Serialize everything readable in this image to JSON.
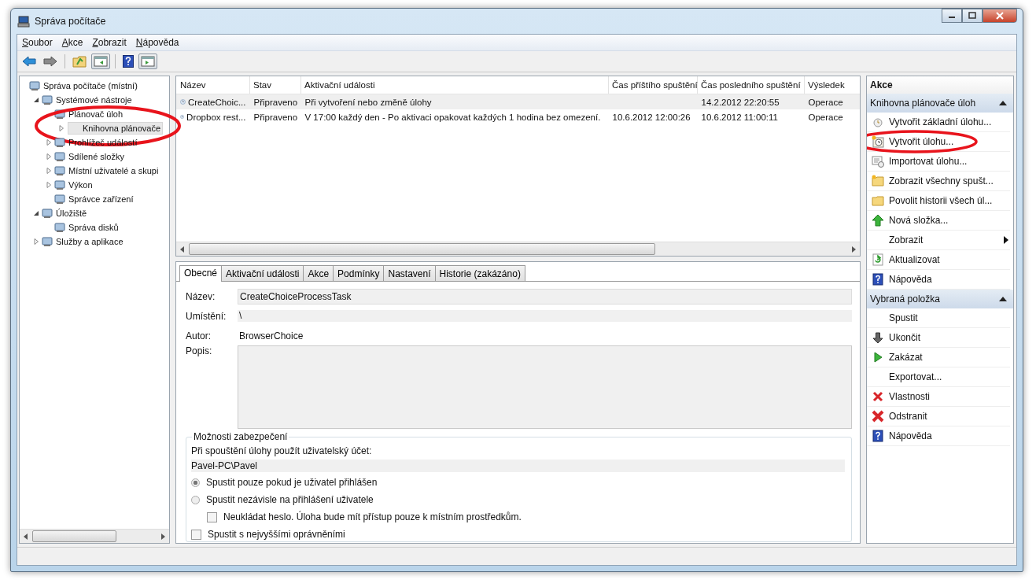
{
  "window": {
    "title": "Správa počítače"
  },
  "menu": [
    "Soubor",
    "Akce",
    "Zobrazit",
    "Nápověda"
  ],
  "tree": [
    {
      "label": "Správa počítače (místní)",
      "selected": false,
      "children": [
        {
          "label": "Systémové nástroje",
          "expanded": true,
          "selected": false,
          "children": [
            {
              "label": "Plánovač úloh",
              "selected": false,
              "children": [
                {
                  "label": "Knihovna plánovače",
                  "expanded": false,
                  "selected": true,
                  "circled": true
                }
              ]
            },
            {
              "label": "Prohlížeč událostí",
              "expanded": false,
              "selected": false
            },
            {
              "label": "Sdílené složky",
              "expanded": false,
              "selected": false
            },
            {
              "label": "Místní uživatelé a skupi",
              "expanded": false,
              "selected": false
            },
            {
              "label": "Výkon",
              "expanded": false,
              "selected": false
            },
            {
              "label": "Správce zařízení",
              "selected": false
            }
          ]
        },
        {
          "label": "Úložiště",
          "expanded": true,
          "selected": false,
          "children": [
            {
              "label": "Správa disků",
              "selected": false
            }
          ]
        },
        {
          "label": "Služby a aplikace",
          "expanded": false,
          "selected": false
        }
      ]
    }
  ],
  "table": {
    "columns": [
      "Název",
      "Stav",
      "Aktivační události",
      "Čas příštího spuštění",
      "Čas posledního spuštění",
      "Výsledek"
    ],
    "rows": [
      {
        "selected": true,
        "cells": [
          "CreateChoic...",
          "Připraveno",
          "Při vytvoření nebo změně úlohy",
          "",
          "14.2.2012 22:20:55",
          "Operace"
        ]
      },
      {
        "selected": false,
        "cells": [
          "Dropbox rest...",
          "Připraveno",
          "V 17:00 každý den - Po aktivaci opakovat každých 1 hodina bez omezení.",
          "10.6.2012 12:00:26",
          "10.6.2012 11:00:11",
          "Operace"
        ]
      }
    ]
  },
  "tabs": [
    {
      "label": "Obecné",
      "selected": true
    },
    {
      "label": "Aktivační události",
      "selected": false
    },
    {
      "label": "Akce",
      "selected": false
    },
    {
      "label": "Podmínky",
      "selected": false
    },
    {
      "label": "Nastavení",
      "selected": false
    },
    {
      "label": "Historie (zakázáno)",
      "selected": false
    }
  ],
  "general": {
    "name_label": "Název:",
    "name_value": "CreateChoiceProcessTask",
    "location_label": "Umístění:",
    "location_value": "\\",
    "author_label": "Autor:",
    "author_value": "BrowserChoice",
    "description_label": "Popis:"
  },
  "security": {
    "title": "Možnosti zabezpečení",
    "account_label": "Při spouštění úlohy použít uživatelský účet:",
    "account_value": "Pavel-PC\\Pavel",
    "radios": [
      {
        "label": "Spustit pouze pokud je uživatel přihlášen",
        "selected": true
      },
      {
        "label": "Spustit nezávisle na přihlášení uživatele",
        "selected": false
      }
    ],
    "dont_store_password": {
      "label": "Neukládat heslo. Úloha bude mít přístup pouze k místním prostředkům.",
      "checked": false
    },
    "highest_privileges": {
      "label": "Spustit s nejvyššími oprávněními",
      "checked": false
    }
  },
  "actions": {
    "title": "Akce",
    "sections": [
      {
        "title": "Knihovna plánovače úloh",
        "expanded": true,
        "items": [
          {
            "label": "Vytvořit základní úlohu..."
          },
          {
            "label": "Vytvořit úlohu...",
            "circled": true
          },
          {
            "label": "Importovat úlohu..."
          },
          {
            "label": "Zobrazit všechny spušt..."
          },
          {
            "label": "Povolit historii všech úl..."
          },
          {
            "label": "Nová složka..."
          },
          {
            "label": "Zobrazit",
            "submenu": true
          },
          {
            "label": "Aktualizovat"
          },
          {
            "label": "Nápověda"
          }
        ]
      },
      {
        "title": "Vybraná položka",
        "expanded": true,
        "items": [
          {
            "label": "Spustit"
          },
          {
            "label": "Ukončit"
          },
          {
            "label": "Zakázat"
          },
          {
            "label": "Exportovat..."
          },
          {
            "label": "Vlastnosti"
          },
          {
            "label": "Odstranit"
          },
          {
            "label": "Nápověda"
          }
        ]
      }
    ]
  }
}
